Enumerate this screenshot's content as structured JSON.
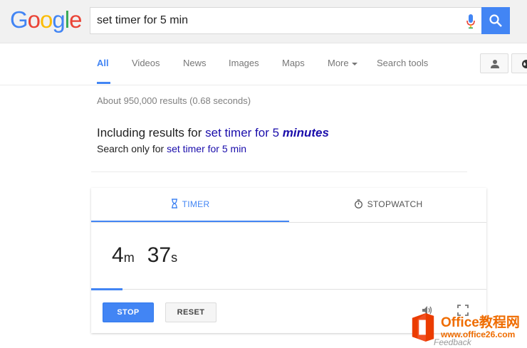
{
  "logo": {
    "letters": [
      "G",
      "o",
      "o",
      "g",
      "l",
      "e"
    ],
    "colors": [
      "#4285f4",
      "#ea4335",
      "#fbbc05",
      "#4285f4",
      "#34a853",
      "#ea4335"
    ]
  },
  "search": {
    "query": "set timer for 5 min"
  },
  "tabs": [
    {
      "label": "All",
      "active": true
    },
    {
      "label": "Videos"
    },
    {
      "label": "News"
    },
    {
      "label": "Images"
    },
    {
      "label": "Maps"
    },
    {
      "label": "More"
    },
    {
      "label": "Search tools"
    }
  ],
  "results": {
    "stats": "About 950,000 results (0.68 seconds)",
    "including_prefix": "Including results for ",
    "including_query": "set timer for 5 ",
    "including_emph": "minutes",
    "search_only_prefix": "Search only for ",
    "search_only_query": "set timer for 5 min"
  },
  "timer": {
    "tab_timer": "TIMER",
    "tab_stopwatch": "STOPWATCH",
    "minutes": "4",
    "minutes_unit": "m",
    "seconds": "37",
    "seconds_unit": "s",
    "progress": 0.08,
    "stop_label": "STOP",
    "reset_label": "RESET"
  },
  "watermark": {
    "line1": "Office教程网",
    "line2": "www.office26.com"
  },
  "feedback": "Feedback",
  "colors": {
    "accent": "#4285f4",
    "link": "#1a0dab",
    "watermark": "#ef6c00"
  }
}
